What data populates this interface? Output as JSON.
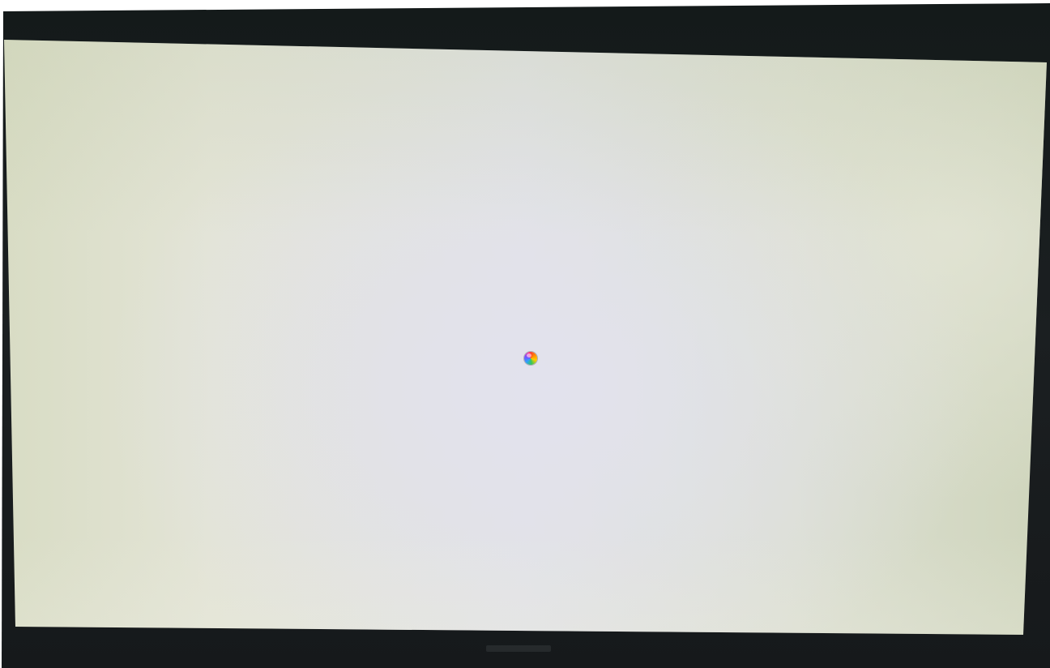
{
  "screen": {
    "state": "blank-loading",
    "cursor": {
      "icon": "spinning-wait-cursor-icon"
    }
  },
  "colors": {
    "bezel": "#16191b",
    "screen_background": "#e2e3e4",
    "cursor_spectrum": [
      "#ff3b30",
      "#ff9500",
      "#ffcc00",
      "#34c759",
      "#2ea0ff",
      "#7d4dff",
      "#ff2d92"
    ]
  }
}
